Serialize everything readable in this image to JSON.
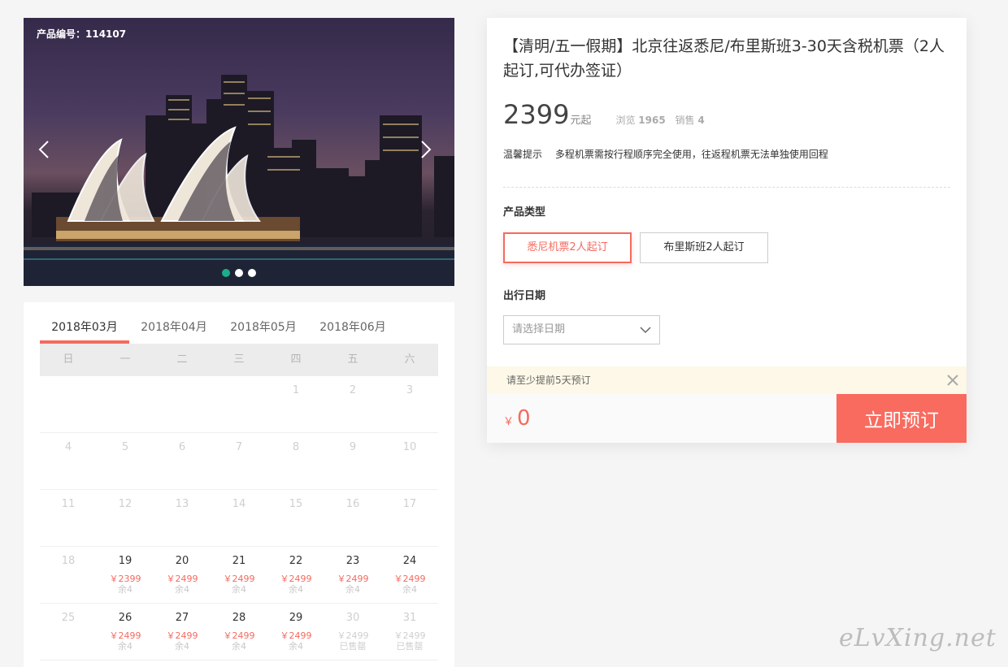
{
  "hero": {
    "product_code": "产品编号：114107",
    "prev_icon": "chevron-left-icon",
    "next_icon": "chevron-right-icon",
    "dot_count": 3,
    "active_dot": 0
  },
  "calendar": {
    "months": [
      "2018年03月",
      "2018年04月",
      "2018年05月",
      "2018年06月"
    ],
    "active_month": 0,
    "weekdays": [
      "日",
      "一",
      "二",
      "三",
      "四",
      "五",
      "六"
    ],
    "days": [
      {
        "day": ""
      },
      {
        "day": ""
      },
      {
        "day": ""
      },
      {
        "day": ""
      },
      {
        "day": "1"
      },
      {
        "day": "2"
      },
      {
        "day": "3"
      },
      {
        "day": "4"
      },
      {
        "day": "5"
      },
      {
        "day": "6"
      },
      {
        "day": "7"
      },
      {
        "day": "8"
      },
      {
        "day": "9"
      },
      {
        "day": "10"
      },
      {
        "day": "11"
      },
      {
        "day": "12"
      },
      {
        "day": "13"
      },
      {
        "day": "14"
      },
      {
        "day": "15"
      },
      {
        "day": "16"
      },
      {
        "day": "17"
      },
      {
        "day": "18"
      },
      {
        "day": "19",
        "price": "￥2399",
        "stock": "余4"
      },
      {
        "day": "20",
        "price": "￥2499",
        "stock": "余4"
      },
      {
        "day": "21",
        "price": "￥2499",
        "stock": "余4"
      },
      {
        "day": "22",
        "price": "￥2499",
        "stock": "余4"
      },
      {
        "day": "23",
        "price": "￥2499",
        "stock": "余4"
      },
      {
        "day": "24",
        "price": "￥2499",
        "stock": "余4"
      },
      {
        "day": "25"
      },
      {
        "day": "26",
        "price": "￥2499",
        "stock": "余4"
      },
      {
        "day": "27",
        "price": "￥2499",
        "stock": "余4"
      },
      {
        "day": "28",
        "price": "￥2499",
        "stock": "余4"
      },
      {
        "day": "29",
        "price": "￥2499",
        "stock": "余4"
      },
      {
        "day": "30",
        "price": "￥2499",
        "stock": "已售罄",
        "soldout": true
      },
      {
        "day": "31",
        "price": "￥2499",
        "stock": "已售罄",
        "soldout": true
      }
    ]
  },
  "product": {
    "title": "【清明/五一假期】北京往返悉尼/布里斯班3-30天含税机票（2人起订,可代办签证）",
    "price": "2399",
    "price_suffix": "元起",
    "views_label": "浏览",
    "views": "1965",
    "sales_label": "销售",
    "sales": "4",
    "tip_label": "温馨提示",
    "tip_text": "多程机票需按行程顺序完全使用，往返程机票无法单独使用回程",
    "type_label": "产品类型",
    "types": [
      "悉尼机票2人起订",
      "布里斯班2人起订"
    ],
    "active_type": 0,
    "date_label": "出行日期",
    "date_placeholder": "请选择日期",
    "notice": "请至少提前5天预订",
    "total_currency": "￥",
    "total": "0",
    "book_label": "立即预订"
  },
  "watermark": "eLvXing.net",
  "colors": {
    "accent": "#f96b5f",
    "active_dot": "#1cae8a",
    "notice_bg": "#fdf8e7"
  }
}
